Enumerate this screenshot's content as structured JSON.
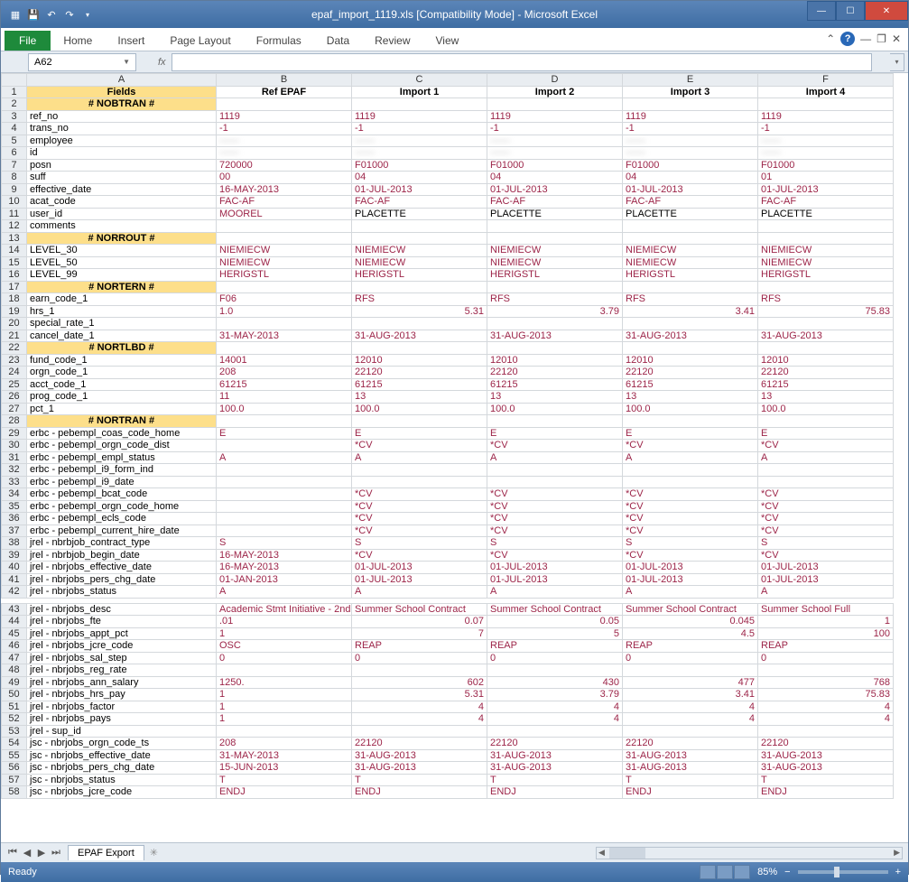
{
  "title": "epaf_import_1119.xls  [Compatibility Mode] - Microsoft Excel",
  "tabs": {
    "file": "File",
    "home": "Home",
    "insert": "Insert",
    "page_layout": "Page Layout",
    "formulas": "Formulas",
    "data": "Data",
    "review": "Review",
    "view": "View"
  },
  "namebox": "A62",
  "sheet_tab": "EPAF Export",
  "status": "Ready",
  "zoom": "85%",
  "columns": [
    "",
    "A",
    "B",
    "C",
    "D",
    "E",
    "F"
  ],
  "headers": {
    "A": "Fields",
    "B": "Ref EPAF",
    "C": "Import 1",
    "D": "Import 2",
    "E": "Import 3",
    "F": "Import 4"
  },
  "rows": [
    {
      "n": 1,
      "type": "header"
    },
    {
      "n": 2,
      "type": "section",
      "A": "# NOBTRAN #"
    },
    {
      "n": 3,
      "A": "ref_no",
      "B": "1119",
      "C": "1119",
      "D": "1119",
      "E": "1119",
      "F": "1119"
    },
    {
      "n": 4,
      "A": "trans_no",
      "B": "-1",
      "C": "-1",
      "D": "-1",
      "E": "-1",
      "F": "-1"
    },
    {
      "n": 5,
      "A": "employee",
      "blur": true,
      "B": "——",
      "C": "——",
      "D": "——",
      "E": "——",
      "F": "——"
    },
    {
      "n": 6,
      "A": "id",
      "blur": true,
      "B": "——",
      "C": "——",
      "D": "——",
      "E": "——",
      "F": "——"
    },
    {
      "n": 7,
      "A": "posn",
      "B": "720000",
      "C": "F01000",
      "D": "F01000",
      "E": "F01000",
      "F": "F01000"
    },
    {
      "n": 8,
      "A": "suff",
      "B": "00",
      "C": "04",
      "D": "04",
      "E": "04",
      "F": "01"
    },
    {
      "n": 9,
      "A": "effective_date",
      "B": "16-MAY-2013",
      "C": "01-JUL-2013",
      "D": "01-JUL-2013",
      "E": "01-JUL-2013",
      "F": "01-JUL-2013"
    },
    {
      "n": 10,
      "A": "acat_code",
      "B": "FAC-AF",
      "C": "FAC-AF",
      "D": "FAC-AF",
      "E": "FAC-AF",
      "F": "FAC-AF"
    },
    {
      "n": 11,
      "A": "user_id",
      "B": "MOOREL",
      "C": "PLACETTE",
      "D": "PLACETTE",
      "E": "PLACETTE",
      "F": "PLACETTE",
      "black": true
    },
    {
      "n": 12,
      "A": "comments"
    },
    {
      "n": 13,
      "type": "section",
      "A": "# NORROUT #"
    },
    {
      "n": 14,
      "A": "LEVEL_30",
      "B": "NIEMIECW",
      "C": "NIEMIECW",
      "D": "NIEMIECW",
      "E": "NIEMIECW",
      "F": "NIEMIECW"
    },
    {
      "n": 15,
      "A": "LEVEL_50",
      "B": "NIEMIECW",
      "C": "NIEMIECW",
      "D": "NIEMIECW",
      "E": "NIEMIECW",
      "F": "NIEMIECW"
    },
    {
      "n": 16,
      "A": "LEVEL_99",
      "B": "HERIGSTL",
      "C": "HERIGSTL",
      "D": "HERIGSTL",
      "E": "HERIGSTL",
      "F": "HERIGSTL"
    },
    {
      "n": 17,
      "type": "section",
      "A": "# NORTERN #"
    },
    {
      "n": 18,
      "A": "earn_code_1",
      "B": "F06",
      "C": "RFS",
      "D": "RFS",
      "E": "RFS",
      "F": "RFS"
    },
    {
      "n": 19,
      "A": "hrs_1",
      "B": "1.0",
      "C": "5.31",
      "D": "3.79",
      "E": "3.41",
      "F": "75.83",
      "num": true
    },
    {
      "n": 20,
      "A": "special_rate_1"
    },
    {
      "n": 21,
      "A": "cancel_date_1",
      "B": "31-MAY-2013",
      "C": "31-AUG-2013",
      "D": "31-AUG-2013",
      "E": "31-AUG-2013",
      "F": "31-AUG-2013"
    },
    {
      "n": 22,
      "type": "section",
      "A": "# NORTLBD #"
    },
    {
      "n": 23,
      "A": "fund_code_1",
      "B": "14001",
      "C": "12010",
      "D": "12010",
      "E": "12010",
      "F": "12010"
    },
    {
      "n": 24,
      "A": "orgn_code_1",
      "B": "208",
      "C": "22120",
      "D": "22120",
      "E": "22120",
      "F": "22120"
    },
    {
      "n": 25,
      "A": "acct_code_1",
      "B": "61215",
      "C": "61215",
      "D": "61215",
      "E": "61215",
      "F": "61215"
    },
    {
      "n": 26,
      "A": "prog_code_1",
      "B": "11",
      "C": "13",
      "D": "13",
      "E": "13",
      "F": "13"
    },
    {
      "n": 27,
      "A": "pct_1",
      "B": "100.0",
      "C": "100.0",
      "D": "100.0",
      "E": "100.0",
      "F": "100.0"
    },
    {
      "n": 28,
      "type": "section",
      "A": "# NORTRAN #"
    },
    {
      "n": 29,
      "A": "erbc - pebempl_coas_code_home",
      "B": "E",
      "C": "E",
      "D": "E",
      "E": "E",
      "F": "E"
    },
    {
      "n": 30,
      "A": "erbc - pebempl_orgn_code_dist",
      "C": "*CV",
      "D": "*CV",
      "E": "*CV",
      "F": "*CV"
    },
    {
      "n": 31,
      "A": "erbc - pebempl_empl_status",
      "B": "A",
      "C": "A",
      "D": "A",
      "E": "A",
      "F": "A"
    },
    {
      "n": 32,
      "A": "erbc - pebempl_i9_form_ind"
    },
    {
      "n": 33,
      "A": "erbc - pebempl_i9_date"
    },
    {
      "n": 34,
      "A": "erbc - pebempl_bcat_code",
      "C": "*CV",
      "D": "*CV",
      "E": "*CV",
      "F": "*CV"
    },
    {
      "n": 35,
      "A": "erbc - pebempl_orgn_code_home",
      "C": "*CV",
      "D": "*CV",
      "E": "*CV",
      "F": "*CV"
    },
    {
      "n": 36,
      "A": "erbc - pebempl_ecls_code",
      "C": "*CV",
      "D": "*CV",
      "E": "*CV",
      "F": "*CV"
    },
    {
      "n": 37,
      "A": "erbc - pebempl_current_hire_date",
      "C": "*CV",
      "D": "*CV",
      "E": "*CV",
      "F": "*CV"
    },
    {
      "n": 38,
      "A": "jrel - nbrbjob_contract_type",
      "B": "S",
      "C": "S",
      "D": "S",
      "E": "S",
      "F": "S"
    },
    {
      "n": 39,
      "A": "jrel - nbrbjob_begin_date",
      "B": "16-MAY-2013",
      "C": "*CV",
      "D": "*CV",
      "E": "*CV",
      "F": "*CV"
    },
    {
      "n": 40,
      "A": "jrel - nbrjobs_effective_date",
      "B": "16-MAY-2013",
      "C": "01-JUL-2013",
      "D": "01-JUL-2013",
      "E": "01-JUL-2013",
      "F": "01-JUL-2013"
    },
    {
      "n": 41,
      "A": "jrel - nbrjobs_pers_chg_date",
      "B": "01-JAN-2013",
      "C": "01-JUL-2013",
      "D": "01-JUL-2013",
      "E": "01-JUL-2013",
      "F": "01-JUL-2013"
    },
    {
      "n": 42,
      "A": "jrel - nbrjobs_status",
      "B": "A",
      "C": "A",
      "D": "A",
      "E": "A",
      "F": "A"
    },
    {
      "n": "gap",
      "type": "gap"
    },
    {
      "n": 43,
      "A": "jrel - nbrjobs_desc",
      "B": "Academic Stmt Initiative - 2nd",
      "C": "Summer School Contract",
      "D": "Summer School Contract",
      "E": "Summer School Contract",
      "F": "Summer School Full"
    },
    {
      "n": 44,
      "A": "jrel - nbrjobs_fte",
      "B": ".01",
      "C": "0.07",
      "D": "0.05",
      "E": "0.045",
      "F": "1",
      "num": true
    },
    {
      "n": 45,
      "A": "jrel - nbrjobs_appt_pct",
      "B": "1",
      "C": "7",
      "D": "5",
      "E": "4.5",
      "F": "100",
      "num": true
    },
    {
      "n": 46,
      "A": "jrel - nbrjobs_jcre_code",
      "B": "OSC",
      "C": "REAP",
      "D": "REAP",
      "E": "REAP",
      "F": "REAP"
    },
    {
      "n": 47,
      "A": "jrel - nbrjobs_sal_step",
      "B": "0",
      "C": "0",
      "D": "0",
      "E": "0",
      "F": "0"
    },
    {
      "n": 48,
      "A": "jrel - nbrjobs_reg_rate"
    },
    {
      "n": 49,
      "A": "jrel - nbrjobs_ann_salary",
      "B": "1250.",
      "C": "602",
      "D": "430",
      "E": "477",
      "F": "768",
      "num": true
    },
    {
      "n": 50,
      "A": "jrel - nbrjobs_hrs_pay",
      "B": "1",
      "C": "5.31",
      "D": "3.79",
      "E": "3.41",
      "F": "75.83",
      "num": true
    },
    {
      "n": 51,
      "A": "jrel - nbrjobs_factor",
      "B": "1",
      "C": "4",
      "D": "4",
      "E": "4",
      "F": "4",
      "num": true
    },
    {
      "n": 52,
      "A": "jrel - nbrjobs_pays",
      "B": "1",
      "C": "4",
      "D": "4",
      "E": "4",
      "F": "4",
      "num": true
    },
    {
      "n": 53,
      "A": "jrel - sup_id"
    },
    {
      "n": 54,
      "A": "jsc - nbrjobs_orgn_code_ts",
      "B": "208",
      "C": "22120",
      "D": "22120",
      "E": "22120",
      "F": "22120"
    },
    {
      "n": 55,
      "A": "jsc - nbrjobs_effective_date",
      "B": "31-MAY-2013",
      "C": "31-AUG-2013",
      "D": "31-AUG-2013",
      "E": "31-AUG-2013",
      "F": "31-AUG-2013"
    },
    {
      "n": 56,
      "A": "jsc - nbrjobs_pers_chg_date",
      "B": "15-JUN-2013",
      "C": "31-AUG-2013",
      "D": "31-AUG-2013",
      "E": "31-AUG-2013",
      "F": "31-AUG-2013"
    },
    {
      "n": 57,
      "A": "jsc - nbrjobs_status",
      "B": "T",
      "C": "T",
      "D": "T",
      "E": "T",
      "F": "T"
    },
    {
      "n": 58,
      "A": "jsc - nbrjobs_jcre_code",
      "B": "ENDJ",
      "C": "ENDJ",
      "D": "ENDJ",
      "E": "ENDJ",
      "F": "ENDJ"
    }
  ]
}
